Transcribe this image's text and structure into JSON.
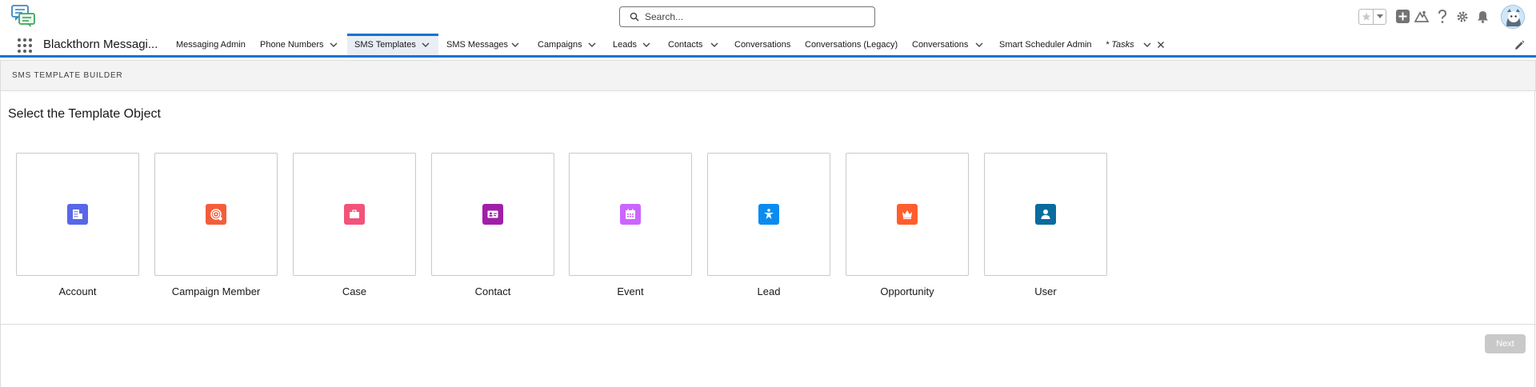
{
  "header": {
    "search_placeholder": "Search...",
    "icons": [
      "app-logo-icon",
      "search-icon",
      "favorite-star-icon",
      "favorites-dropdown-icon",
      "global-add-icon",
      "trailhead-icon",
      "help-icon",
      "setup-gear-icon",
      "notifications-bell-icon",
      "user-avatar"
    ]
  },
  "nav": {
    "app_name": "Blackthorn Messagi...",
    "items": [
      {
        "label": "Messaging Admin",
        "has_menu": false
      },
      {
        "label": "Phone Numbers",
        "has_menu": true
      },
      {
        "label": "SMS Templates",
        "has_menu": true,
        "active": true
      },
      {
        "label": "SMS Messages",
        "has_menu": true
      },
      {
        "label": "Campaigns",
        "has_menu": true
      },
      {
        "label": "Leads",
        "has_menu": true
      },
      {
        "label": "Contacts",
        "has_menu": true
      },
      {
        "label": "Conversations",
        "has_menu": false
      },
      {
        "label": "Conversations (Legacy)",
        "has_menu": false
      },
      {
        "label": "Conversations",
        "has_menu": true
      },
      {
        "label": "Smart Scheduler Admin",
        "has_menu": false
      },
      {
        "label": "* Tasks",
        "has_menu": true,
        "closable": true
      }
    ]
  },
  "builder": {
    "title": "SMS TEMPLATE BUILDER",
    "heading": "Select the Template Object",
    "objects": [
      {
        "label": "Account",
        "icon": "account-icon",
        "color": "#5867e8"
      },
      {
        "label": "Campaign Member",
        "icon": "campaign-member-icon",
        "color": "#f45d3a"
      },
      {
        "label": "Case",
        "icon": "case-icon",
        "color": "#f2537a"
      },
      {
        "label": "Contact",
        "icon": "contact-icon",
        "color": "#a01fa8"
      },
      {
        "label": "Event",
        "icon": "event-icon",
        "color": "#cb65ff"
      },
      {
        "label": "Lead",
        "icon": "lead-icon",
        "color": "#0b8bf0"
      },
      {
        "label": "Opportunity",
        "icon": "opportunity-icon",
        "color": "#ff5d2d"
      },
      {
        "label": "User",
        "icon": "user-icon",
        "color": "#0b6b9e"
      }
    ],
    "next_label": "Next"
  },
  "colors": {
    "brand": "#0176d3",
    "active_tab_bg": "#e9eef5",
    "disabled_button": "#c9c9c9"
  }
}
